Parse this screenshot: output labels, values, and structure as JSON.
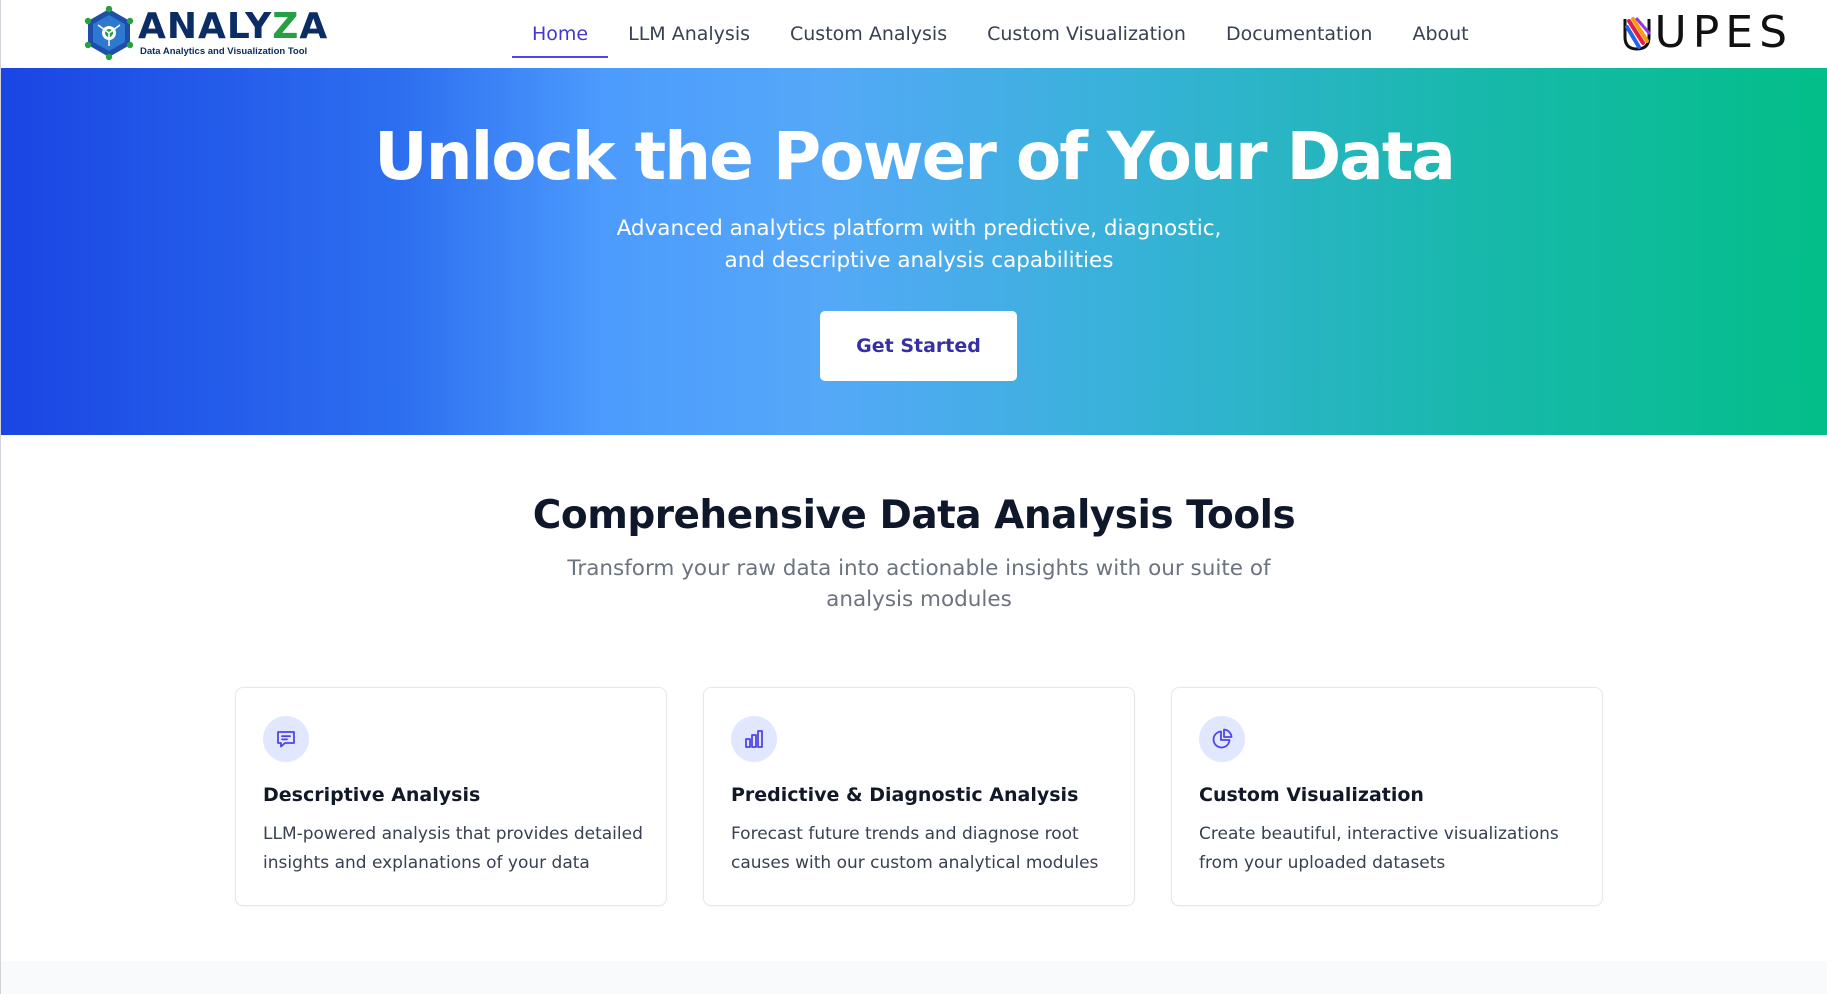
{
  "brand": {
    "name_main": "ANALY",
    "name_accent": "Z",
    "name_end": "A",
    "tagline": "Data Analytics and Visualization Tool",
    "partner": "UPES"
  },
  "nav": {
    "items": [
      {
        "label": "Home",
        "active": true
      },
      {
        "label": "LLM Analysis",
        "active": false
      },
      {
        "label": "Custom Analysis",
        "active": false
      },
      {
        "label": "Custom Visualization",
        "active": false
      },
      {
        "label": "Documentation",
        "active": false
      },
      {
        "label": "About",
        "active": false
      }
    ]
  },
  "hero": {
    "title": "Unlock the Power of Your Data",
    "subtitle": "Advanced analytics platform with predictive, diagnostic, and descriptive analysis capabilities",
    "cta_label": "Get Started"
  },
  "features": {
    "title": "Comprehensive Data Analysis Tools",
    "subtitle": "Transform your raw data into actionable insights with our suite of analysis modules",
    "cards": [
      {
        "icon": "chat-icon",
        "title": "Descriptive Analysis",
        "description": "LLM-powered analysis that provides detailed insights and explanations of your data"
      },
      {
        "icon": "bar-chart-icon",
        "title": "Predictive & Diagnostic Analysis",
        "description": "Forecast future trends and diagnose root causes with our custom analytical modules"
      },
      {
        "icon": "pie-chart-icon",
        "title": "Custom Visualization",
        "description": "Create beautiful, interactive visualizations from your uploaded datasets"
      }
    ]
  },
  "colors": {
    "primary": "#4f46e5",
    "hero_start": "#1a45e3",
    "hero_mid": "#55a8f8",
    "hero_end": "#03be88",
    "icon_bg": "#e0e7ff"
  }
}
